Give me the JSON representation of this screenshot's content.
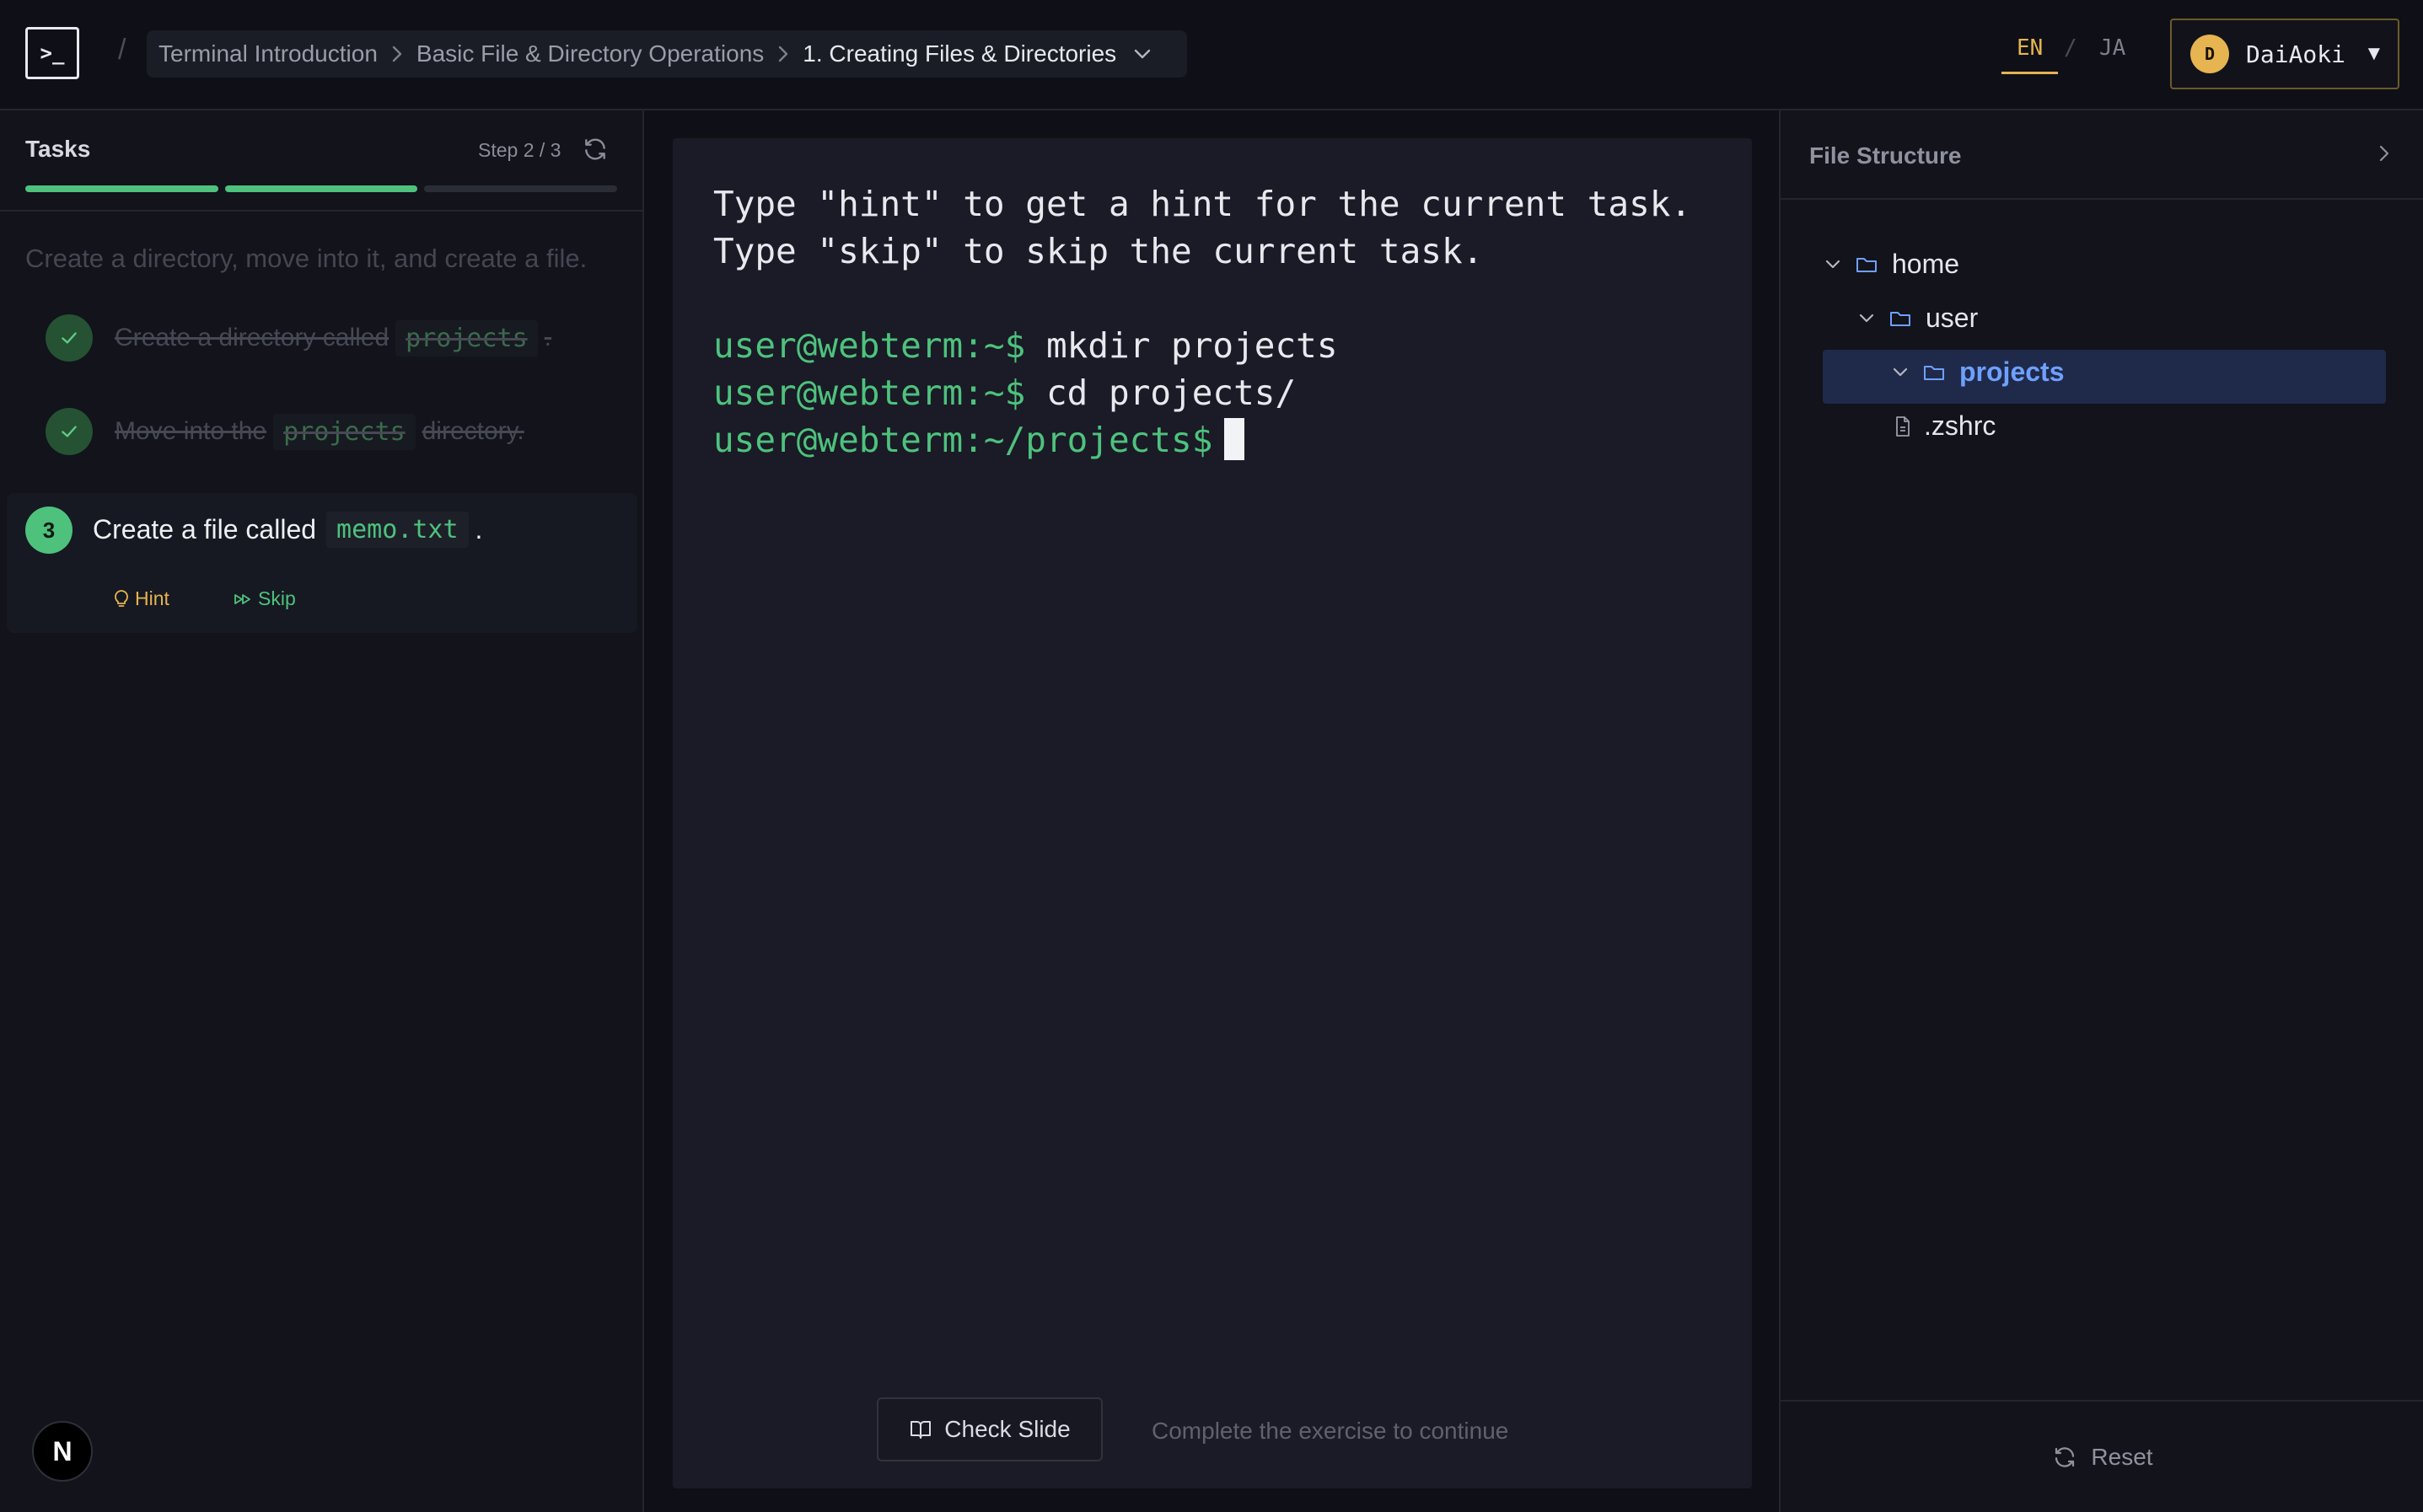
{
  "header": {
    "logo": ">_",
    "separator": "/",
    "breadcrumb": [
      "Terminal Introduction",
      "Basic File & Directory Operations",
      "1. Creating Files & Directories"
    ],
    "lang_en": "EN",
    "lang_sep": "/",
    "lang_ja": "JA",
    "user_initial": "D",
    "username": "DaiAoki",
    "user_caret": "▼"
  },
  "tasks": {
    "title": "Tasks",
    "step": "Step 2 / 3",
    "progress": {
      "completed": 2,
      "total": 3
    },
    "description": "Create a directory, move into it, and create a file.",
    "items": [
      {
        "pre": "Create a directory called",
        "code": "projects",
        "post": "."
      },
      {
        "pre": "Move into the",
        "code": "projects",
        "post": "directory."
      },
      {
        "number": "3",
        "pre": "Create a file called",
        "code": "memo.txt",
        "post": "."
      }
    ],
    "hint_label": "Hint",
    "skip_label": "Skip"
  },
  "terminal": {
    "info_lines": [
      "Type \"hint\" to get a hint for the current task.",
      "Type \"skip\" to skip the current task."
    ],
    "history": [
      {
        "prompt": "user@webterm:~$",
        "command": "mkdir projects"
      },
      {
        "prompt": "user@webterm:~$",
        "command": "cd projects/"
      },
      {
        "prompt": "user@webterm:~/projects$",
        "command": ""
      }
    ],
    "check_slide_label": "Check Slide",
    "continue_text": "Complete the exercise to continue"
  },
  "files": {
    "title": "File Structure",
    "tree": [
      {
        "name": "home",
        "type": "folder"
      },
      {
        "name": "user",
        "type": "folder"
      },
      {
        "name": "projects",
        "type": "folder",
        "selected": true
      },
      {
        "name": ".zshrc",
        "type": "file"
      }
    ],
    "reset_label": "Reset"
  },
  "badge": "N",
  "colors": {
    "accent_green": "#4ec27d",
    "accent_yellow": "#e6b450",
    "accent_blue": "#6fa0ff",
    "background": "#0f1017",
    "terminal_bg": "#1a1b26"
  }
}
